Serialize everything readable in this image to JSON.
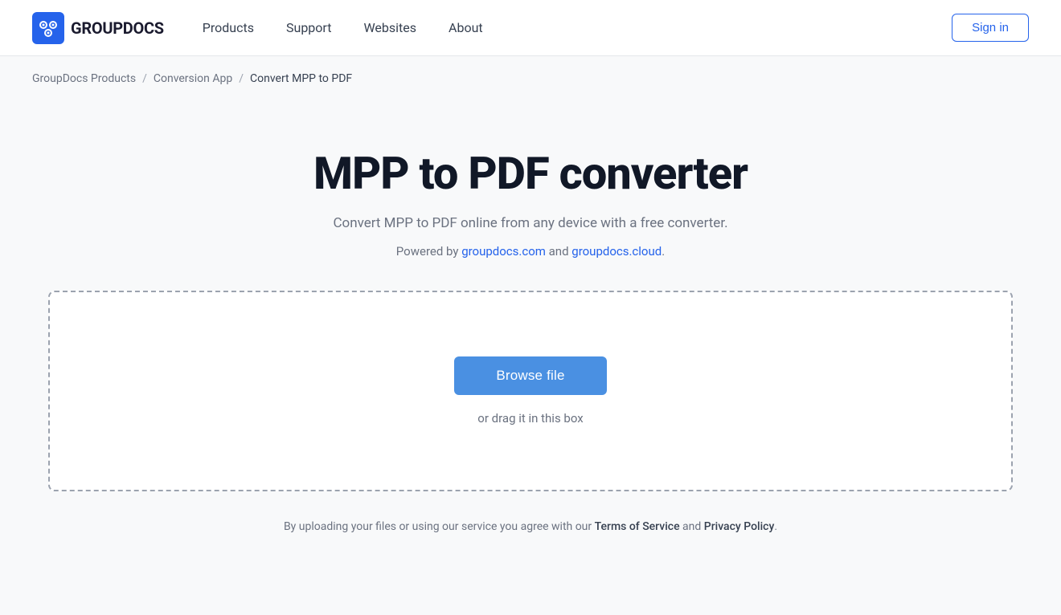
{
  "navbar": {
    "logo_text": "GROUPDOCS",
    "nav_items": [
      {
        "label": "Products",
        "id": "products"
      },
      {
        "label": "Support",
        "id": "support"
      },
      {
        "label": "Websites",
        "id": "websites"
      },
      {
        "label": "About",
        "id": "about"
      }
    ],
    "sign_in_label": "Sign in"
  },
  "breadcrumb": {
    "items": [
      {
        "label": "GroupDocs Products",
        "id": "groupdocs-products"
      },
      {
        "label": "Conversion App",
        "id": "conversion-app"
      },
      {
        "label": "Convert MPP to PDF",
        "id": "convert-current"
      }
    ]
  },
  "main": {
    "title": "MPP to PDF converter",
    "subtitle": "Convert MPP to PDF online from any device with a free converter.",
    "powered_by_prefix": "Powered by ",
    "powered_by_link1": "groupdocs.com",
    "powered_by_link2": "groupdocs.cloud",
    "powered_by_and": " and ",
    "powered_by_suffix": ".",
    "browse_button_label": "Browse file",
    "drag_text": "or drag it in this box",
    "footer_disclaimer_prefix": "By uploading your files or using our service you agree with our ",
    "terms_label": "Terms of Service",
    "footer_and": " and ",
    "privacy_label": "Privacy Policy",
    "footer_suffix": "."
  },
  "colors": {
    "accent_blue": "#4a90e2",
    "link_blue": "#2563eb",
    "border_dashed": "#9ca3af"
  }
}
